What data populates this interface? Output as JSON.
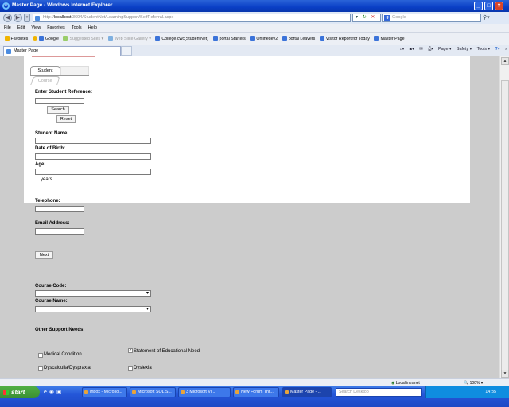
{
  "window": {
    "title": "Master Page - Windows Internet Explorer"
  },
  "address": {
    "url_prefix": "http://",
    "url_host": "localhost",
    "url_rest": ":3694/StudentNet/LearningSupport/SelfReferral.aspx",
    "search_placeholder": "Google"
  },
  "menu": [
    "File",
    "Edit",
    "View",
    "Favorites",
    "Tools",
    "Help"
  ],
  "favorites": [
    {
      "label": "Favorites",
      "dim": false
    },
    {
      "label": "Google",
      "dim": false
    },
    {
      "label": "Suggested Sites ▾",
      "dim": true
    },
    {
      "label": "Web Slice Gallery ▾",
      "dim": true
    },
    {
      "label": "College.cwc(StudentNet)",
      "dim": false
    },
    {
      "label": "portal Starters",
      "dim": false
    },
    {
      "label": "Onlinedev2",
      "dim": false
    },
    {
      "label": "portal Leavers",
      "dim": false
    },
    {
      "label": "Visitor Report for Today",
      "dim": false
    },
    {
      "label": "Master Page",
      "dim": false
    }
  ],
  "tab": {
    "label": "Master Page"
  },
  "commands": [
    "Page ▾",
    "Safety ▾",
    "Tools ▾",
    "»"
  ],
  "form": {
    "tabs": [
      "Student",
      "Course"
    ],
    "enter_ref_label": "Enter Student Reference:",
    "search_button": "Search",
    "reset_button": "Reset",
    "student_name_label": "Student Name:",
    "dob_label": "Date of Birth:",
    "age_label": "Age:",
    "years_label": "years",
    "telephone_label": "Telephone:",
    "email_label": "Email Address:",
    "next_button": "Next",
    "course_code_label": "Course Code:",
    "course_name_label": "Course Name:",
    "other_support_label": "Other Support Needs:",
    "checkboxes": [
      {
        "label": "Medical Condition",
        "checked": false
      },
      {
        "label": "Statement of Educational Need",
        "checked": true
      },
      {
        "label": "Dyscalculia/Dyspraxia",
        "checked": false
      },
      {
        "label": "Dyslexia",
        "checked": false
      }
    ]
  },
  "status": {
    "zone": "Local intranet",
    "zoom": "100%"
  },
  "taskbar": {
    "start": "start",
    "buttons": [
      {
        "label": "Inbox - Microso...",
        "active": false
      },
      {
        "label": "Microsoft SQL S...",
        "active": false
      },
      {
        "label": "3 Microsoft Vi...",
        "active": false
      },
      {
        "label": "New Forum Thr...",
        "active": false
      },
      {
        "label": "Master Page - ...",
        "active": true
      }
    ],
    "search_placeholder": "Search Desktop",
    "clock": "14:35"
  }
}
